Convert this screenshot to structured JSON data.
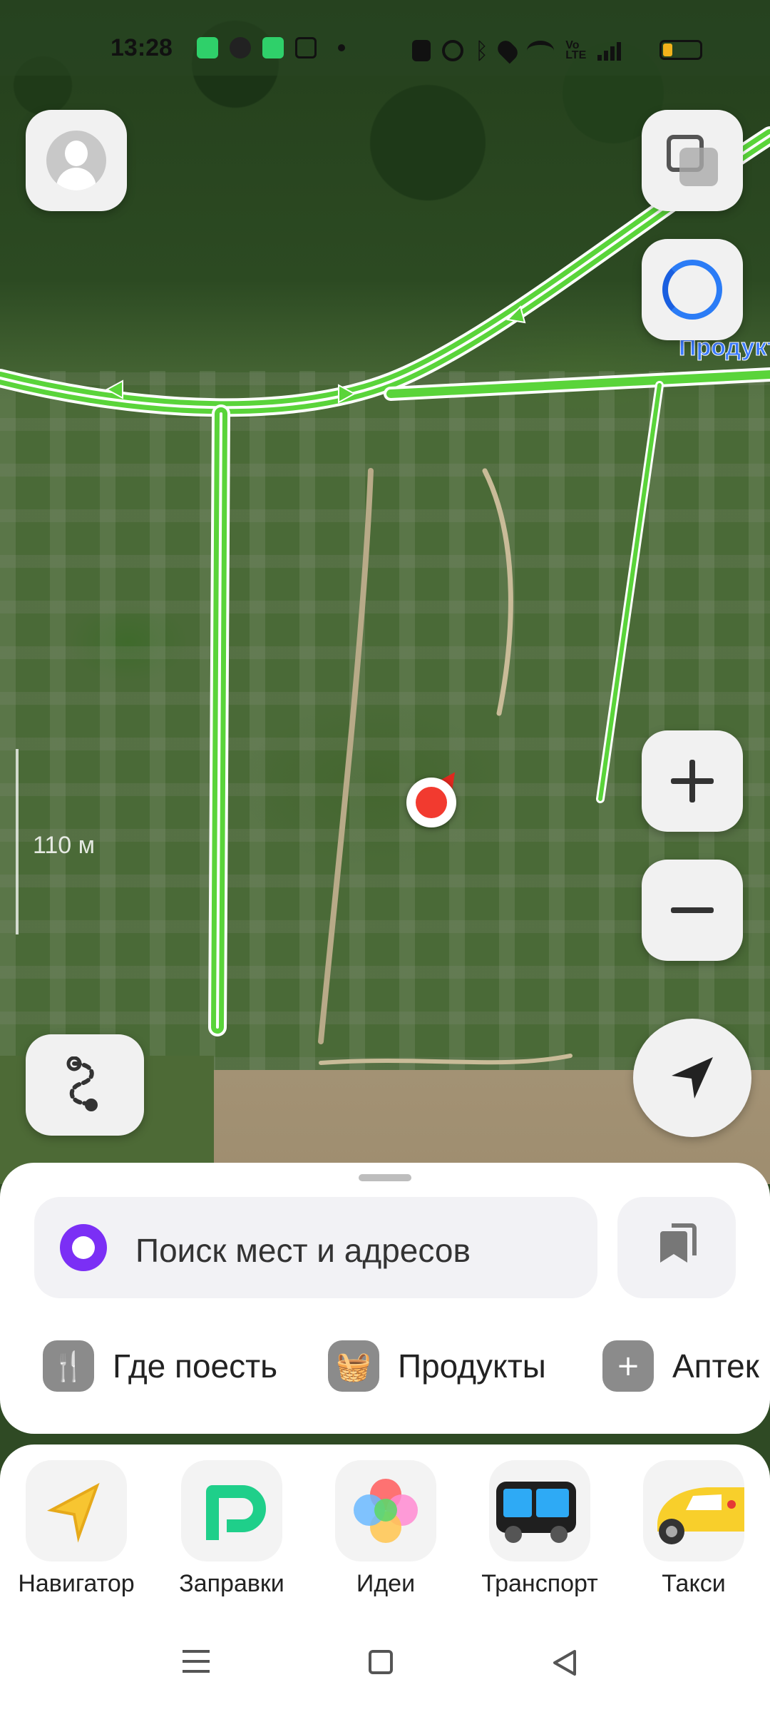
{
  "status_bar": {
    "time": "13:28",
    "icons": [
      "messages-icon",
      "alien-icon",
      "battery-app-icon",
      "instagram-icon",
      "dot-icon",
      "nfc-icon",
      "alarm-icon",
      "bluetooth-icon",
      "location-icon",
      "wifi-icon",
      "volte-icon",
      "signal-icon"
    ],
    "battery_level": 0.25,
    "battery_color": "#f2b21b"
  },
  "map": {
    "scale_label": "110 м",
    "poi_label": "Продукт",
    "road_color": "#5ad43a",
    "user_pin_color": "#f23a2f"
  },
  "search": {
    "placeholder": "Поиск мест и адресов"
  },
  "categories": [
    {
      "label": "Где поесть",
      "icon": "fork-knife-icon"
    },
    {
      "label": "Продукты",
      "icon": "basket-icon"
    },
    {
      "label": "Аптек",
      "icon": "plus-icon"
    }
  ],
  "apps": [
    {
      "label": "Навигатор",
      "icon": "navigator-icon"
    },
    {
      "label": "Заправки",
      "icon": "gas-station-icon"
    },
    {
      "label": "Идеи",
      "icon": "ideas-icon"
    },
    {
      "label": "Транспорт",
      "icon": "bus-icon"
    },
    {
      "label": "Такси",
      "icon": "taxi-icon"
    }
  ],
  "accent_color": "#7b2ff5"
}
